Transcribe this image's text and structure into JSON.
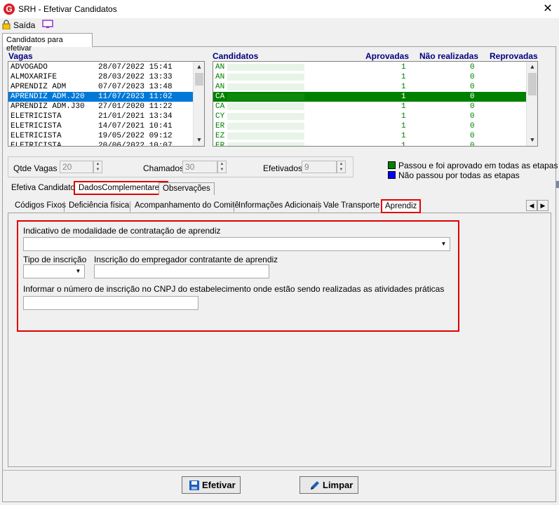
{
  "window": {
    "title": "SRH - Efetivar Candidatos",
    "close": "✕",
    "app_icon": "G"
  },
  "toolbar": {
    "exit_label": "Saída"
  },
  "main_tab": {
    "label": "Candidatos para efetivar"
  },
  "vagas": {
    "header": "Vagas",
    "rows": [
      {
        "name": "ADVOGADO",
        "date": "28/07/2022 15:41"
      },
      {
        "name": "ALMOXARIFE",
        "date": "28/03/2022 13:33"
      },
      {
        "name": "APRENDIZ ADM",
        "date": "07/07/2023 13:48"
      },
      {
        "name": "APRENDIZ ADM.J20",
        "date": "11/07/2023 11:02"
      },
      {
        "name": "APRENDIZ ADM.J30",
        "date": "27/01/2020 11:22"
      },
      {
        "name": "ELETRICISTA",
        "date": "21/01/2021 13:34"
      },
      {
        "name": "ELETRICISTA",
        "date": "14/07/2021 10:41"
      },
      {
        "name": "ELETRICISTA",
        "date": "19/05/2022 09:12"
      },
      {
        "name": "ELETRICISTA",
        "date": "20/06/2022 10:07"
      }
    ]
  },
  "candidatos": {
    "header": "Candidatos",
    "col_aprovadas": "Aprovadas",
    "col_nao_realizadas": "Não realizadas",
    "col_reprovadas": "Reprovadas",
    "rows": [
      {
        "name": "AN",
        "aprovadas": "1",
        "nao_realizadas": "0"
      },
      {
        "name": "AN",
        "aprovadas": "1",
        "nao_realizadas": "0"
      },
      {
        "name": "AN",
        "aprovadas": "1",
        "nao_realizadas": "0"
      },
      {
        "name": "CA",
        "aprovadas": "1",
        "nao_realizadas": "0"
      },
      {
        "name": "CA",
        "aprovadas": "1",
        "nao_realizadas": "0"
      },
      {
        "name": "CY",
        "aprovadas": "1",
        "nao_realizadas": "0"
      },
      {
        "name": "ER",
        "aprovadas": "1",
        "nao_realizadas": "0"
      },
      {
        "name": "EZ",
        "aprovadas": "1",
        "nao_realizadas": "0"
      },
      {
        "name": "ER",
        "aprovadas": "1",
        "nao_realizadas": "0"
      }
    ]
  },
  "stats": {
    "qtde_vagas_label": "Qtde Vagas",
    "qtde_vagas": "20",
    "chamados_label": "Chamados",
    "chamados": "30",
    "efetivados_label": "Efetivados",
    "efetivados": "9"
  },
  "legend": {
    "passed": "Passou e foi aprovado em todas as etapas",
    "not_passed": "Não passou por todas as etapas",
    "passed_color": "#008000",
    "not_passed_color": "#0000ff"
  },
  "tabs_level2": [
    "Efetiva Candidato",
    "DadosComplementares",
    "Observações"
  ],
  "tabs_level3": [
    "Códigos Fixos",
    "Deficiência física",
    "Acompanhamento do Comitê",
    "Informações Adicionais",
    "Vale Transporte",
    "Aprendiz"
  ],
  "aprendiz": {
    "modalidade_label": "Indicativo de modalidade de contratação de aprendiz",
    "modalidade_value": "",
    "tipo_inscricao_label": "Tipo de inscrição",
    "tipo_inscricao_value": "",
    "inscricao_empregador_label": "Inscrição do empregador contratante de aprendiz",
    "inscricao_empregador_value": "",
    "cnpj_label": "Informar o número de inscrição no CNPJ do estabelecimento onde estão sendo realizadas as atividades práticas",
    "cnpj_value": ""
  },
  "buttons": {
    "efetivar": "Efetivar",
    "limpar": "Limpar"
  }
}
